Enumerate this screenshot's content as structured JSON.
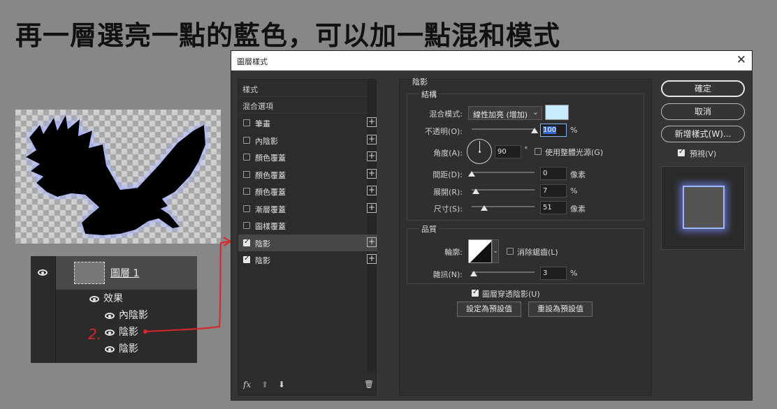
{
  "headline": "再一層選亮一點的藍色，可以加一點混和模式",
  "layers_panel": {
    "layer_name": "圖層 1",
    "effects_label": "效果",
    "effects": [
      "內陰影",
      "陰影",
      "陰影"
    ],
    "annotation_number": "2."
  },
  "dialog": {
    "title": "圖層樣式",
    "close": "✕",
    "styles_panel": {
      "header": "樣式",
      "blending_options": "混合選項",
      "items": [
        {
          "label": "筆畫",
          "checked": false,
          "has_plus": true
        },
        {
          "label": "內陰影",
          "checked": false,
          "has_plus": true
        },
        {
          "label": "顏色覆蓋",
          "checked": false,
          "has_plus": true
        },
        {
          "label": "顏色覆蓋",
          "checked": false,
          "has_plus": true
        },
        {
          "label": "顏色覆蓋",
          "checked": false,
          "has_plus": true
        },
        {
          "label": "漸層覆蓋",
          "checked": false,
          "has_plus": true
        },
        {
          "label": "圖樣覆蓋",
          "checked": false,
          "has_plus": false
        },
        {
          "label": "陰影",
          "checked": true,
          "has_plus": true,
          "selected": true
        },
        {
          "label": "陰影",
          "checked": true,
          "has_plus": true
        }
      ],
      "footer": {
        "fx": "fx",
        "up": "⬆",
        "down": "⬇",
        "trash": "🗑"
      }
    },
    "drop_shadow": {
      "title": "陰影",
      "structure": {
        "title": "結構",
        "blend_mode_label": "混合模式:",
        "blend_mode_value": "線性加亮 (增加)",
        "color": "#c7ecff",
        "opacity_label": "不透明(O):",
        "opacity_value": "100",
        "opacity_unit": "%",
        "opacity_fraction": 1.0,
        "angle_label": "角度(A):",
        "angle_value": "90",
        "angle_unit": "°",
        "global_light_label": "使用整體光源(G)",
        "global_light_checked": false,
        "distance_label": "間距(D):",
        "distance_value": "0",
        "distance_unit": "像素",
        "distance_fraction": 0.0,
        "spread_label": "展開(R):",
        "spread_value": "7",
        "spread_unit": "%",
        "spread_fraction": 0.07,
        "size_label": "尺寸(S):",
        "size_value": "51",
        "size_unit": "像素",
        "size_fraction": 0.2
      },
      "quality": {
        "title": "品質",
        "contour_label": "輪廓:",
        "anti_alias_label": "消除鋸齒(L)",
        "anti_alias_checked": false,
        "noise_label": "雜訊(N):",
        "noise_value": "3",
        "noise_unit": "%",
        "noise_fraction": 0.03
      },
      "layer_knocks_out_label": "圖層穿透陰影(U)",
      "layer_knocks_out_checked": true,
      "make_default": "設定為預設值",
      "reset_default": "重設為預設值"
    },
    "buttons": {
      "ok": "確定",
      "cancel": "取消",
      "new_style": "新增樣式(W)...",
      "preview_label": "預視(V)",
      "preview_checked": true
    }
  }
}
